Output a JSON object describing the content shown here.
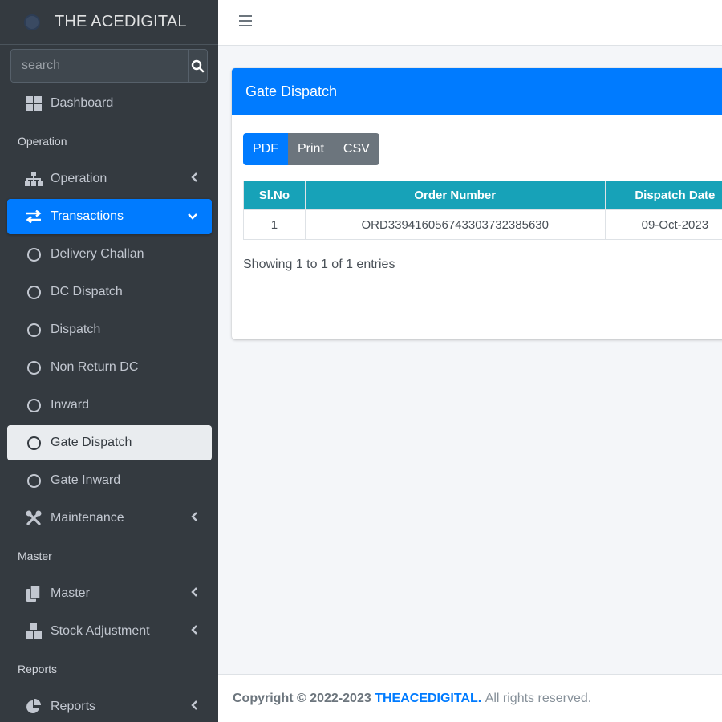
{
  "brand": {
    "name": "THE ACEDIGITAL"
  },
  "search": {
    "placeholder": "search"
  },
  "sidebar": {
    "dashboard": "Dashboard",
    "header_operation": "Operation",
    "operation": "Operation",
    "transactions": "Transactions",
    "sub_items": [
      "Delivery Challan",
      "DC Dispatch",
      "Dispatch",
      "Non Return DC",
      "Inward",
      "Gate Dispatch",
      "Gate Inward"
    ],
    "maintenance": "Maintenance",
    "header_master": "Master",
    "master": "Master",
    "stock_adjustment": "Stock Adjustment",
    "header_reports": "Reports",
    "reports": "Reports"
  },
  "card": {
    "title": "Gate Dispatch",
    "buttons": [
      "PDF",
      "Print",
      "CSV"
    ],
    "table": {
      "headers": [
        "Sl.No",
        "Order Number",
        "Dispatch Date"
      ],
      "rows": [
        [
          "1",
          "ORD33941605674330373238563​0",
          "09-Oct-2023"
        ]
      ]
    },
    "info": "Showing 1 to 1 of 1 entries"
  },
  "footer": {
    "prefix": "Copyright © 2022-2023",
    "brand": "THEACEDIGITAL.",
    "suffix": "All rights reserved."
  },
  "colors": {
    "primary": "#007bff",
    "sidebar": "#343a40",
    "table_header": "#17a2b8",
    "secondary": "#6c757d"
  }
}
